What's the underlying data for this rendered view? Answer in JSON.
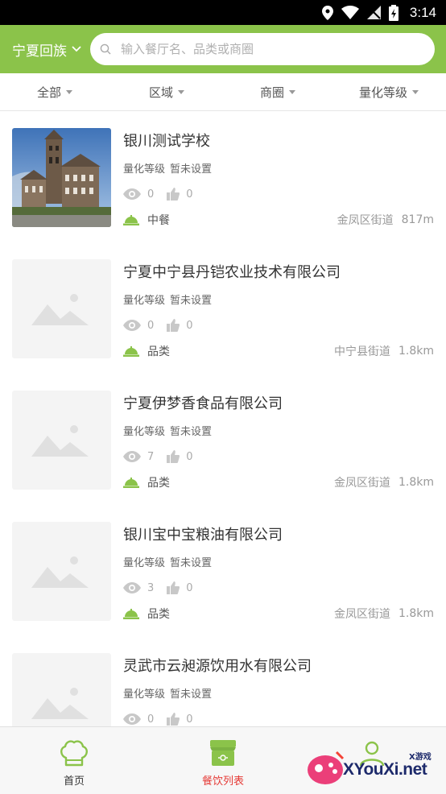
{
  "status_bar": {
    "time": "3:14"
  },
  "header": {
    "city": "宁夏回族",
    "search_placeholder": "输入餐厅名、品类或商圈"
  },
  "filters": [
    {
      "label": "全部"
    },
    {
      "label": "区域"
    },
    {
      "label": "商圈"
    },
    {
      "label": "量化等级"
    }
  ],
  "restaurants": [
    {
      "name": "银川测试学校",
      "level_label": "量化等级",
      "level_value": "暂未设置",
      "views": "0",
      "likes": "0",
      "category": "中餐",
      "district": "金凤区街道",
      "distance": "817m",
      "has_photo": true
    },
    {
      "name": "宁夏中宁县丹铠农业技术有限公司",
      "level_label": "量化等级",
      "level_value": "暂未设置",
      "views": "0",
      "likes": "0",
      "category": "品类",
      "district": "中宁县街道",
      "distance": "1.8km",
      "has_photo": false
    },
    {
      "name": "宁夏伊梦香食品有限公司",
      "level_label": "量化等级",
      "level_value": "暂未设置",
      "views": "7",
      "likes": "0",
      "category": "品类",
      "district": "金凤区街道",
      "distance": "1.8km",
      "has_photo": false
    },
    {
      "name": "银川宝中宝粮油有限公司",
      "level_label": "量化等级",
      "level_value": "暂未设置",
      "views": "3",
      "likes": "0",
      "category": "品类",
      "district": "金凤区街道",
      "distance": "1.8km",
      "has_photo": false
    },
    {
      "name": "灵武市云昶源饮用水有限公司",
      "level_label": "量化等级",
      "level_value": "暂未设置",
      "views": "0",
      "likes": "0",
      "category": "",
      "district": "",
      "distance": "",
      "has_photo": false
    }
  ],
  "bottom_nav": [
    {
      "label": "首页",
      "icon": "chef-hat-icon",
      "active": false
    },
    {
      "label": "餐饮列表",
      "icon": "storefront-icon",
      "active": true
    },
    {
      "label": "",
      "icon": "person-icon",
      "active": false
    }
  ],
  "watermark": {
    "text": "XYouXi.net",
    "small": "X游戏"
  },
  "colors": {
    "brand_green": "#8bc34a",
    "active_red": "#e53935",
    "placeholder_gray": "#f4f4f4"
  }
}
